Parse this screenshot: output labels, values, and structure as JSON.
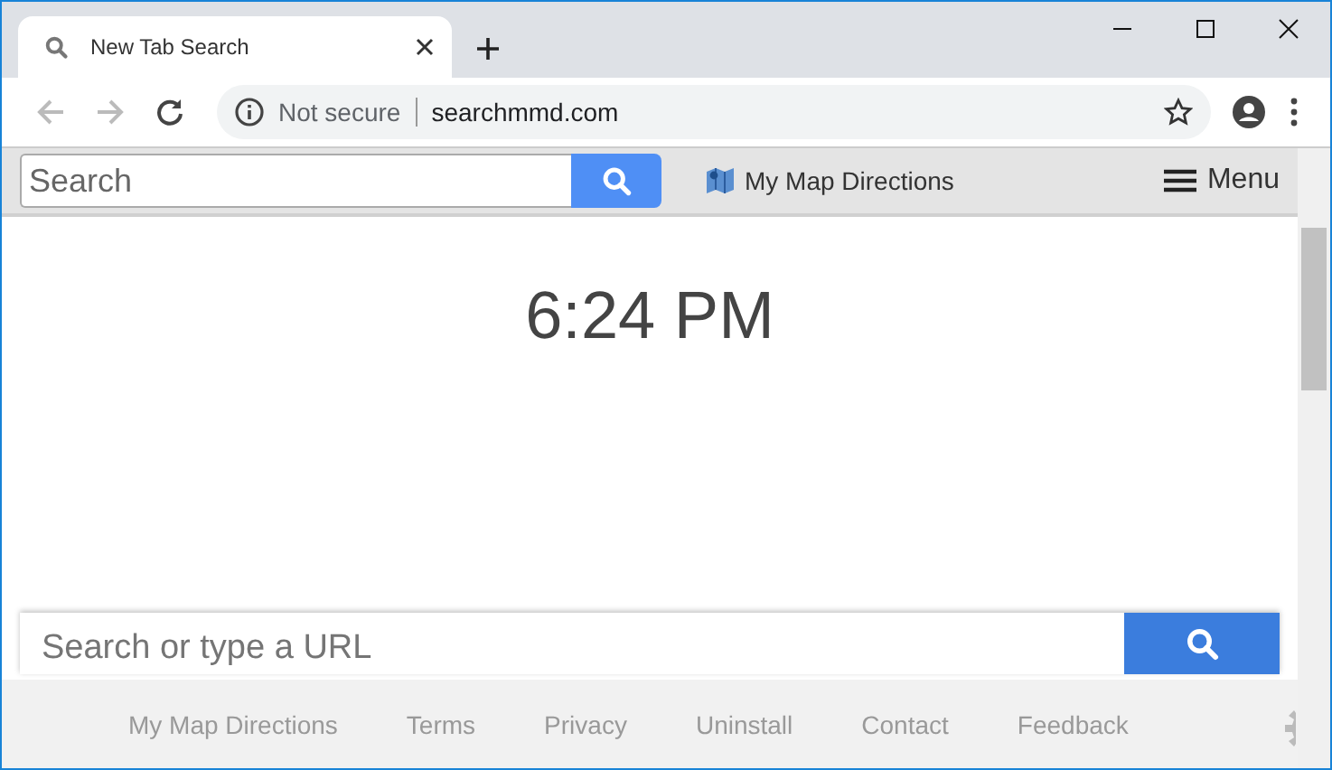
{
  "tab": {
    "title": "New Tab Search"
  },
  "toolbar": {
    "security": "Not secure",
    "url": "searchmmd.com"
  },
  "header": {
    "search": {
      "placeholder": "Search"
    },
    "brand": "My Map Directions",
    "menu": "Menu"
  },
  "clock": "6:24 PM",
  "main_search": {
    "placeholder": "Search or type a URL"
  },
  "footer": {
    "links": [
      "My Map Directions",
      "Terms",
      "Privacy",
      "Uninstall",
      "Contact",
      "Feedback"
    ]
  }
}
